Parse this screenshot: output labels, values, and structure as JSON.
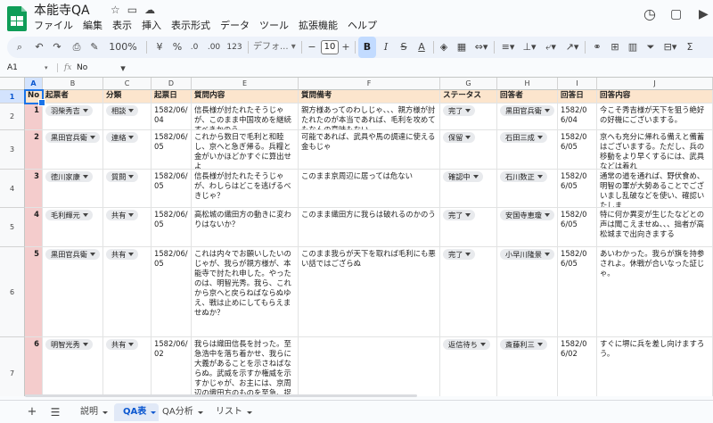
{
  "doc_title": "本能寺QA",
  "menu": [
    "ファイル",
    "編集",
    "表示",
    "挿入",
    "表示形式",
    "データ",
    "ツール",
    "拡張機能",
    "ヘルプ"
  ],
  "toolbar": {
    "zoom": "100%",
    "currency": "¥",
    "percent": "%",
    "dec_less": ".0",
    "dec_more": ".00",
    "num_format": "123",
    "font": "デフォ...",
    "font_size": "10",
    "bold": "B",
    "italic": "I",
    "strike": "S",
    "text_color": "A"
  },
  "formula_bar": {
    "cell": "A1",
    "value": "No"
  },
  "columns": [
    "A",
    "B",
    "C",
    "D",
    "E",
    "F",
    "G",
    "H",
    "I",
    "J"
  ],
  "header_row": [
    "No",
    "起票者",
    "分類",
    "起票日",
    "質問内容",
    "質問備考",
    "ステータス",
    "回答者",
    "回答日",
    "回答内容"
  ],
  "rows": [
    {
      "num": "2",
      "no": "1",
      "by": "羽柴秀吉",
      "cat": "相談",
      "date": "1582/06/04",
      "q": "信長様が討たれたそうじゃが、このまま中国攻めを継続すべきかのう",
      "note": "親方様あってのわしじゃ、、、親方様が討たれたのが本当であれば、毛利を攻めてもなんの意味もない",
      "status": "完了",
      "ans": "黒田官兵衛",
      "adate": "1582/06/04",
      "a": "今こそ秀吉様が天下を狙う絶好の好機にございまする。"
    },
    {
      "num": "3",
      "no": "2",
      "by": "黒田官兵衛",
      "cat": "連絡",
      "date": "1582/06/05",
      "q": "これから数日で毛利と和睦し、京へと急ぎ帰る。兵糧と金がいかほどかすぐに算出せよ",
      "note": "可能であれば、武具や馬の調達に使える金もじゃ",
      "status": "保留",
      "ans": "石田三成",
      "adate": "1582/06/05",
      "a": "京へも充分に帰れる備えと備蓄はございまする。ただし、兵の移動をより早くするには、武具などは着れ"
    },
    {
      "num": "4",
      "no": "3",
      "by": "徳川家康",
      "cat": "質問",
      "date": "1582/06/05",
      "q": "信長様が討たれたそうじゃが、わしらはどこを逃げるべきじゃ？",
      "note": "このまま京周辺に居っては危ない",
      "status": "確認中",
      "ans": "石川数正",
      "adate": "1582/06/05",
      "a": "通常の道を通れば、野伏食め、明智の軍が大勢あることでございまし乱破などを使い、確認いたしま"
    },
    {
      "num": "5",
      "no": "4",
      "by": "毛利輝元",
      "cat": "共有",
      "date": "1582/06/05",
      "q": "高松城の織田方の動きに変わりはないか？",
      "note": "このまま織田方に我らは破れるのかのう",
      "status": "完了",
      "ans": "安国寺恵瓊",
      "adate": "1582/06/05",
      "a": "特に何か異変が生じたなどとの声は聞こえませぬ、、、拙者が高松城まで出向きまする"
    },
    {
      "num": "6",
      "no": "5",
      "by": "黒田官兵衛",
      "cat": "共有",
      "date": "1582/06/05",
      "q": "これは内々でお願いしたいのじゃが、我らが親方様が、本能寺で討たれ申した。やったのは、明智光秀。我ら、これから京へと戻らねばならぬゆえ、戦は止めにしてもらえませぬか？",
      "note": "このまま我らが天下を取れば毛利にも悪い話ではござらぬ",
      "status": "完了",
      "ans": "小早川隆景",
      "adate": "1582/06/05",
      "a": "あいわかった。我らが旗を持参されよ。休戦が合いなった証じゃ。"
    },
    {
      "num": "7",
      "no": "6",
      "by": "明智光秀",
      "cat": "共有",
      "date": "1582/06/02",
      "q": "我らは織田信長を討った。至急浩中を落ち着かせ、我らに大義があることを示さねばならぬ。武威を示すか権威を示すかじゃが、お主には、京周辺の織田方のものを至急、捉えてもらいたい。堺にある松平など",
      "note": "",
      "status": "返信待ち",
      "ans": "斎藤利三",
      "adate": "1582/06/02",
      "a": "すぐに堺に兵を差し向けますろう。"
    }
  ],
  "sheet_tabs": [
    "説明",
    "QA表",
    "QA分析",
    "リスト"
  ],
  "active_tab": "QA表"
}
